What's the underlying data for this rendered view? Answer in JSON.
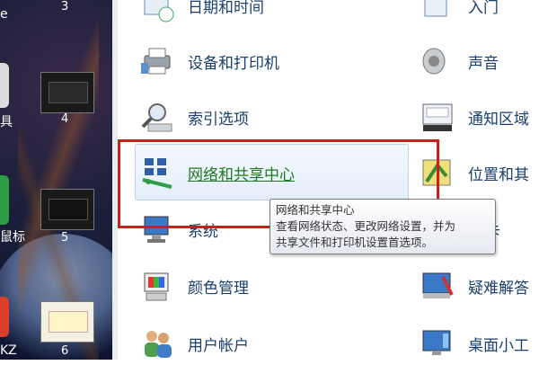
{
  "left_strip": {
    "thumb_numbers": [
      "3",
      "4",
      "5",
      "6"
    ],
    "side_labels": [
      "e",
      "具",
      "鼠标",
      "KZ"
    ]
  },
  "control_panel": {
    "left_items": [
      {
        "id": "date-time",
        "label": "日期和时间"
      },
      {
        "id": "devices-printers",
        "label": "设备和打印机"
      },
      {
        "id": "indexing-options",
        "label": "索引选项"
      },
      {
        "id": "network-sharing-center",
        "label": "网络和共享中心"
      },
      {
        "id": "system",
        "label": "系统"
      },
      {
        "id": "color-management",
        "label": "颜色管理"
      },
      {
        "id": "user-accounts",
        "label": "用户帐户"
      }
    ],
    "right_items": [
      {
        "id": "getting-started",
        "label": "入门"
      },
      {
        "id": "sound",
        "label": "声音"
      },
      {
        "id": "notification-area",
        "label": "通知区域"
      },
      {
        "id": "location",
        "label": "位置和其"
      },
      {
        "id": "fonts",
        "label": "卡"
      },
      {
        "id": "troubleshooting",
        "label": "疑难解答"
      },
      {
        "id": "desktop-gadgets",
        "label": "桌面小工"
      }
    ]
  },
  "tooltip": {
    "title": "网络和共享中心",
    "line1": "查看网络状态、更改网络设置，并为",
    "line2": "共享文件和打印机设置首选项。"
  },
  "colors": {
    "highlight_box": "#d21c1c",
    "link_text": "#1f7a1f",
    "item_text": "#1a3f6e"
  }
}
